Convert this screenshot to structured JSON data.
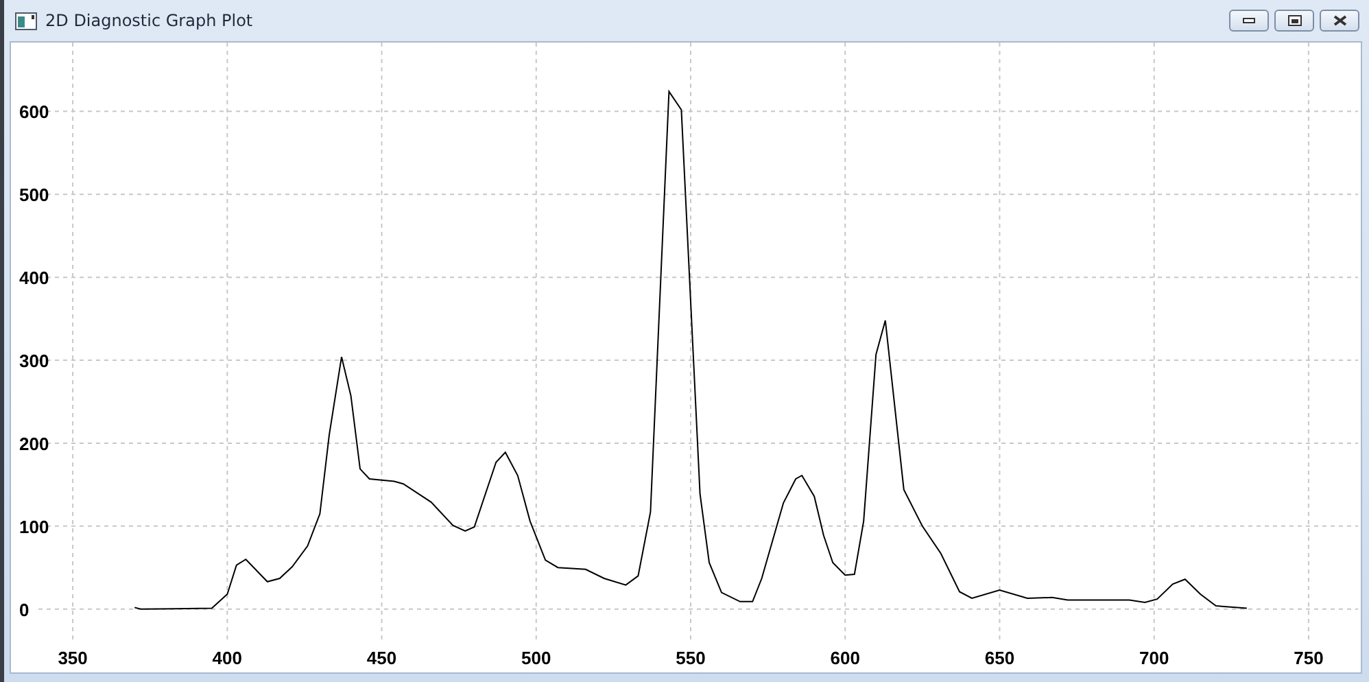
{
  "window": {
    "title": "2D Diagnostic Graph Plot"
  },
  "plot": {
    "chart_data": {
      "type": "line",
      "x": [
        370,
        372,
        395,
        400,
        403,
        406,
        413,
        417,
        421,
        426,
        430,
        433,
        437,
        440,
        443,
        446,
        454,
        457,
        466,
        473,
        477,
        480,
        487,
        490,
        494,
        498,
        503,
        507,
        516,
        522,
        529,
        533,
        537,
        543,
        547,
        553,
        556,
        560,
        566,
        570,
        573,
        580,
        584,
        586,
        590,
        593,
        596,
        600,
        603,
        606,
        610,
        613,
        619,
        625,
        631,
        637,
        641,
        650,
        659,
        667,
        672,
        692,
        697,
        701,
        706,
        710,
        715,
        720,
        730
      ],
      "series": [
        {
          "color": "#000000",
          "values": [
            2,
            0,
            1,
            18,
            53,
            60,
            33,
            37,
            51,
            76,
            115,
            210,
            304,
            257,
            169,
            157,
            154,
            151,
            129,
            101,
            94,
            99,
            177,
            189,
            161,
            106,
            59,
            50,
            48,
            37,
            29,
            40,
            117,
            624,
            602,
            139,
            56,
            20,
            9,
            9,
            37,
            128,
            157,
            161,
            136,
            89,
            56,
            41,
            42,
            106,
            307,
            348,
            144,
            100,
            67,
            21,
            13,
            23,
            13,
            14,
            11,
            11,
            8,
            12,
            30,
            36,
            18,
            4,
            1
          ]
        }
      ],
      "xticks": [
        350,
        400,
        450,
        500,
        550,
        600,
        650,
        700,
        750
      ],
      "yticks": [
        0,
        100,
        200,
        300,
        400,
        500,
        600
      ],
      "xlim": [
        330,
        766
      ],
      "ylim": [
        -73,
        683
      ],
      "grid": true
    }
  }
}
